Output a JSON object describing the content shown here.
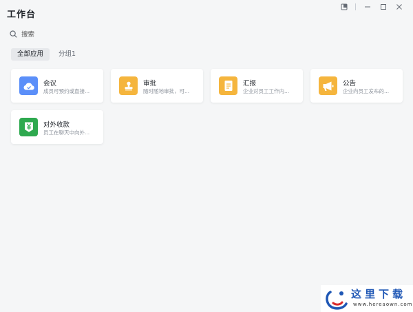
{
  "header": {
    "title": "工作台"
  },
  "search": {
    "label": "搜索"
  },
  "tabs": [
    {
      "label": "全部应用",
      "active": true
    },
    {
      "label": "分组1",
      "active": false
    }
  ],
  "apps": [
    {
      "name": "会议",
      "desc": "成员可预约或直接...",
      "icon": "cloud-icon",
      "color": "#5b8ff9"
    },
    {
      "name": "审批",
      "desc": "随时随地审批，可...",
      "icon": "stamp-icon",
      "color": "#f5b53d"
    },
    {
      "name": "汇报",
      "desc": "企业对员工工作内...",
      "icon": "document-icon",
      "color": "#f5b53d"
    },
    {
      "name": "公告",
      "desc": "企业向员工发布的...",
      "icon": "megaphone-icon",
      "color": "#f5b53d"
    },
    {
      "name": "对外收款",
      "desc": "员工在聊天中向外...",
      "icon": "yuan-icon",
      "color": "#2ea94f"
    }
  ],
  "watermark": {
    "text": "这里下载",
    "url": "www.hereaown.com"
  }
}
